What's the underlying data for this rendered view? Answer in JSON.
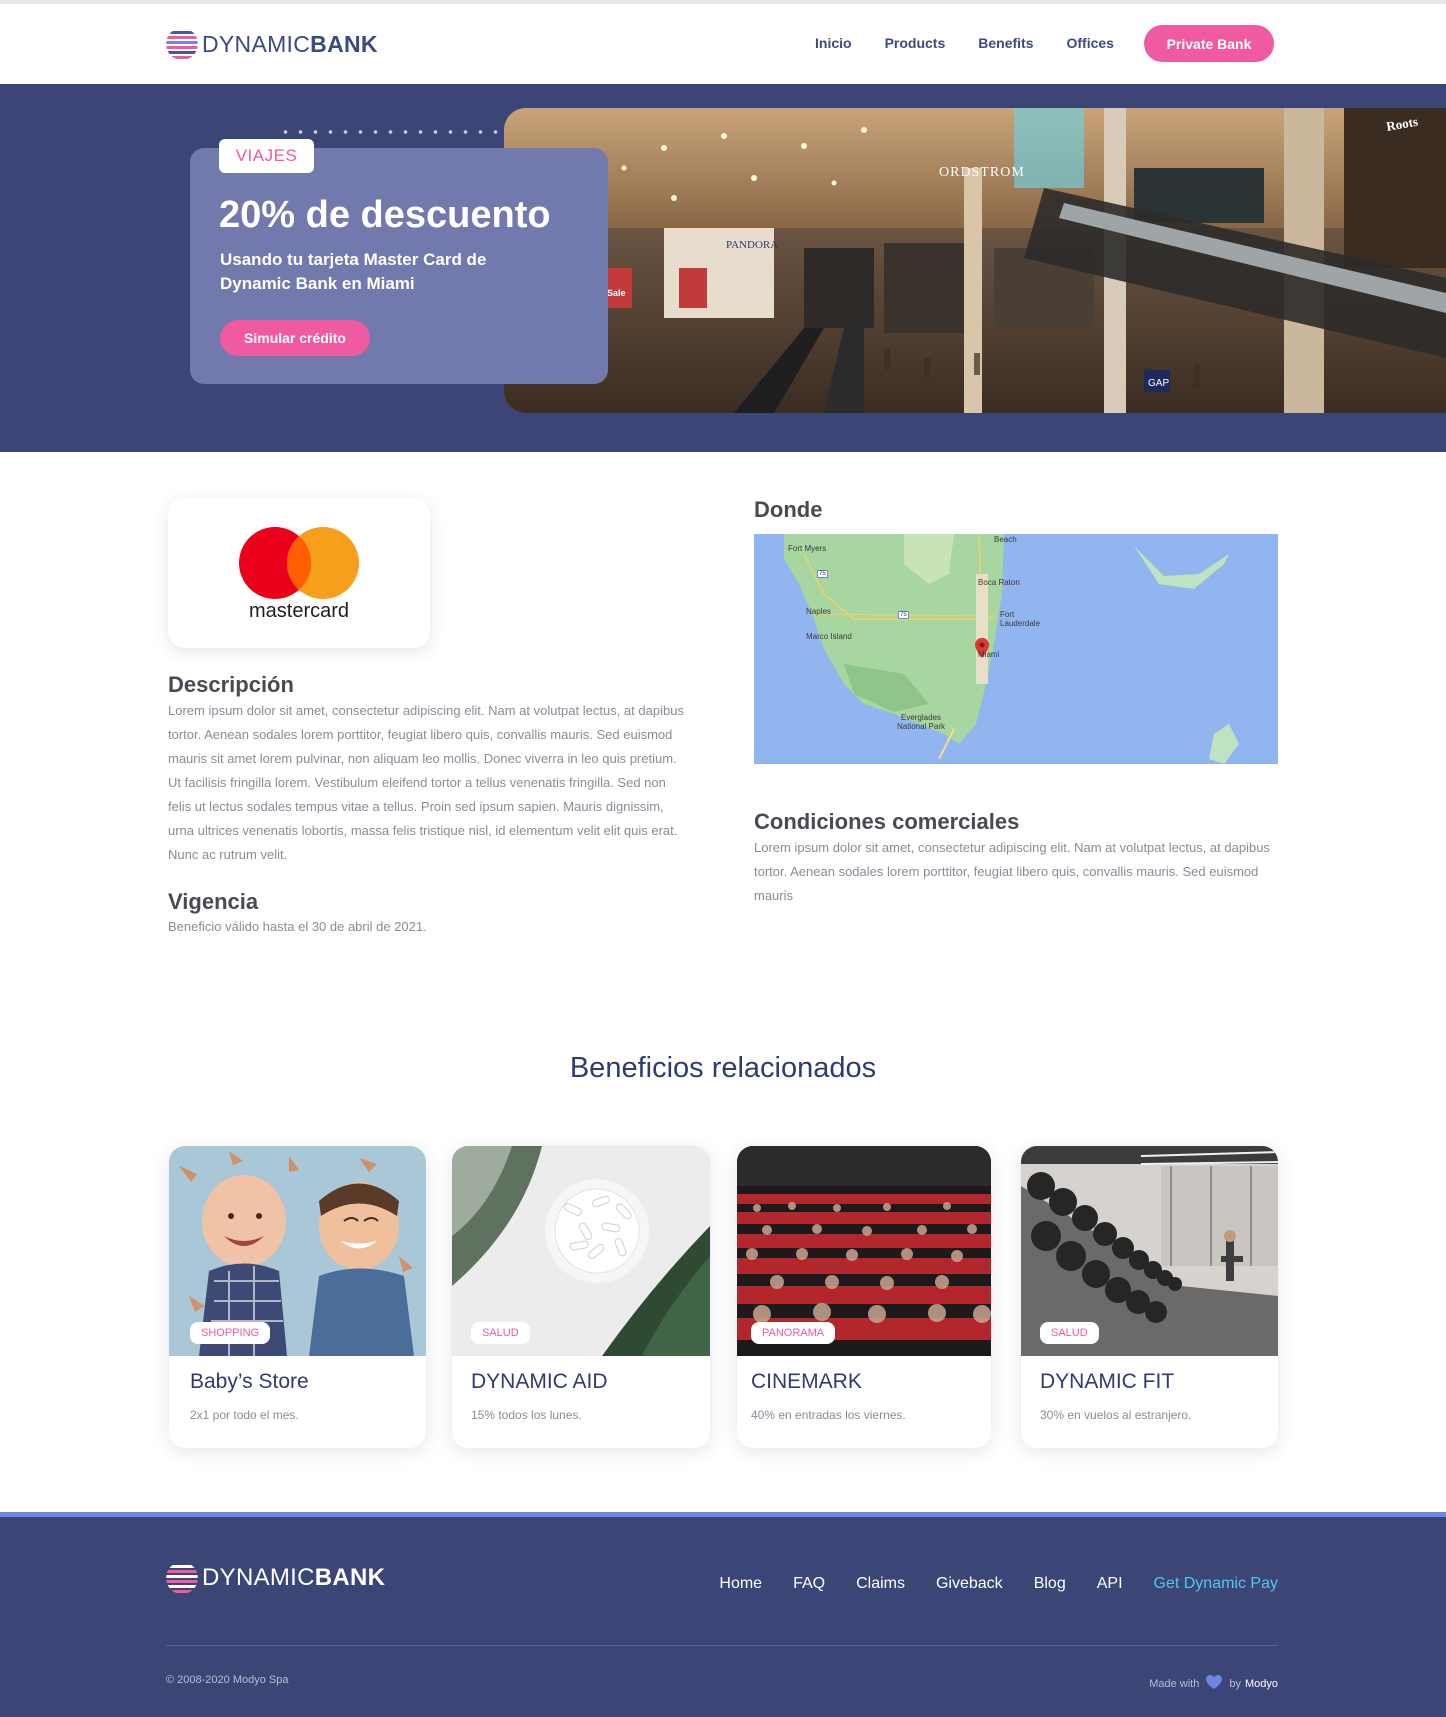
{
  "header": {
    "logo_light": "DYNAMIC",
    "logo_bold": "BANK",
    "nav": [
      "Inicio",
      "Products",
      "Benefits",
      "Offices"
    ],
    "cta": "Private Bank"
  },
  "hero": {
    "tag": "VIAJES",
    "title": "20% de descuento",
    "subtitle": "Usando tu tarjeta Master Card de Dynamic Bank en Miami",
    "button": "Simular crédito",
    "photo_text": [
      "ORDSTROM",
      "PANDORA",
      "Roots",
      "GAP",
      "Sale"
    ]
  },
  "detail": {
    "card_brand": "mastercard",
    "description_title": "Descripción",
    "description_text": "Lorem ipsum dolor sit amet, consectetur adipiscing elit. Nam at volutpat lectus, at dapibus tortor. Aenean sodales lorem porttitor, feugiat libero quis, convallis mauris. Sed euismod mauris sit amet lorem pulvinar, non aliquam leo mollis. Donec viverra in leo quis pretium. Ut facilisis fringilla lorem. Vestibulum eleifend tortor a tellus venenatis fringilla. Sed non felis ut lectus sodales tempus vitae a tellus. Proin sed ipsum sapien. Mauris dignissim, urna ultrices venenatis lobortis, massa felis tristique nisl, id elementum velit elit quis erat. Nunc ac rutrum velit.",
    "validity_title": "Vigencia",
    "validity_text": "Beneficio válido hasta el 30 de abril de 2021.",
    "where_title": "Donde",
    "conditions_title": "Condiciones comerciales",
    "conditions_text": "Lorem ipsum dolor sit amet, consectetur adipiscing elit. Nam at volutpat lectus, at dapibus tortor. Aenean sodales lorem porttitor, feugiat libero quis, convallis mauris. Sed euismod mauris"
  },
  "map_labels": {
    "fort_myers": "Fort Myers",
    "beach": "Beach",
    "boca_raton": "Boca Raton",
    "fort_lauderdale": "Fort Lauderdale",
    "naples": "Naples",
    "marco_island": "Marco Island",
    "miami": "Miami",
    "everglades": "Everglades National Park",
    "highway_75a": "75",
    "highway_75b": "75"
  },
  "related": {
    "title": "Beneficios relacionados",
    "cards": [
      {
        "tag": "SHOPPING",
        "title": "Baby’s Store",
        "desc": "2x1 por todo el mes."
      },
      {
        "tag": "SALUD",
        "title": "DYNAMIC AID",
        "desc": "15% todos los lunes."
      },
      {
        "tag": "PANORAMA",
        "title": "CINEMARK",
        "desc": "40% en entradas los viernes."
      },
      {
        "tag": "SALUD",
        "title": "DYNAMIC FIT",
        "desc": "30% en vuelos al estranjero."
      }
    ]
  },
  "footer": {
    "logo_light": "DYNAMIC",
    "logo_bold": "BANK",
    "links": [
      "Home",
      "FAQ",
      "Claims",
      "Giveback",
      "Blog",
      "API"
    ],
    "highlight_link": "Get Dynamic Pay",
    "copyright": "© 2008-2020 Modyo Spa",
    "made_with": "Made with",
    "by": "by",
    "brand": "Modyo"
  },
  "colors": {
    "navy": "#3b4576",
    "pink": "#ef5aa1",
    "card_purple": "#7279ad",
    "link_cyan": "#55c6ec",
    "footer_accent": "#6e86e2"
  },
  "icons": [
    "dynamicbank-logo-icon",
    "mastercard-logo-icon",
    "map-pin-icon",
    "heart-icon"
  ]
}
